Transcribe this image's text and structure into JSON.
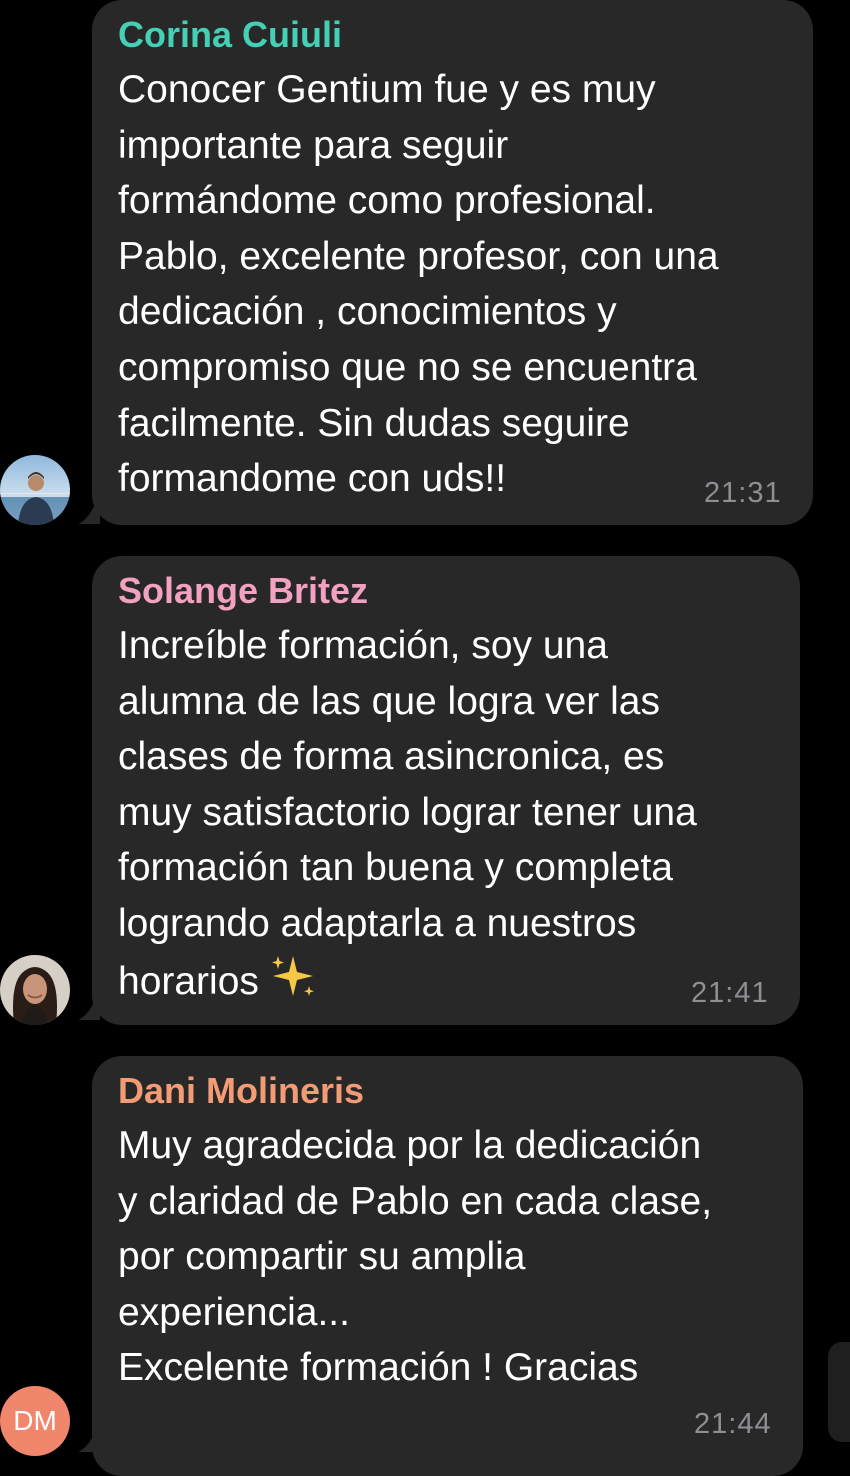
{
  "messages": [
    {
      "sender": "Corina Cuiuli",
      "sender_color": "#45d0b5",
      "text": "Conocer Gentium fue y es muy\nimportante para seguir\nformándome como profesional.\nPablo, excelente profesor, con una\ndedicación , conocimientos y\ncompromiso que no se encuentra\nfacilmente. Sin dudas seguire\nformandome con uds!!",
      "time": "21:31",
      "avatar": "photo-beach"
    },
    {
      "sender": "Solange Britez",
      "sender_color": "#f2a1c0",
      "text": "Increíble formación, soy una\nalumna de las que logra ver las\nclases de forma asincronica, es\nmuy satisfactorio lograr tener una\nformación tan buena y completa\nlogrando adaptarla a nuestros\nhorarios",
      "emoji": "sparkles-icon",
      "time": "21:41",
      "avatar": "photo-portrait"
    },
    {
      "sender": "Dani Molineris",
      "sender_color": "#f29b74",
      "text": "Muy agradecida por la dedicación\ny claridad de Pablo en cada clase,\npor compartir su amplia\nexperiencia...\nExcelente formación ! Gracias",
      "time": "21:44",
      "avatar_initials": "DM",
      "avatar_color": "#f0876c"
    }
  ],
  "colors": {
    "background": "#000000",
    "bubble": "#282829",
    "text": "#ffffff",
    "time": "#8e8e93"
  }
}
